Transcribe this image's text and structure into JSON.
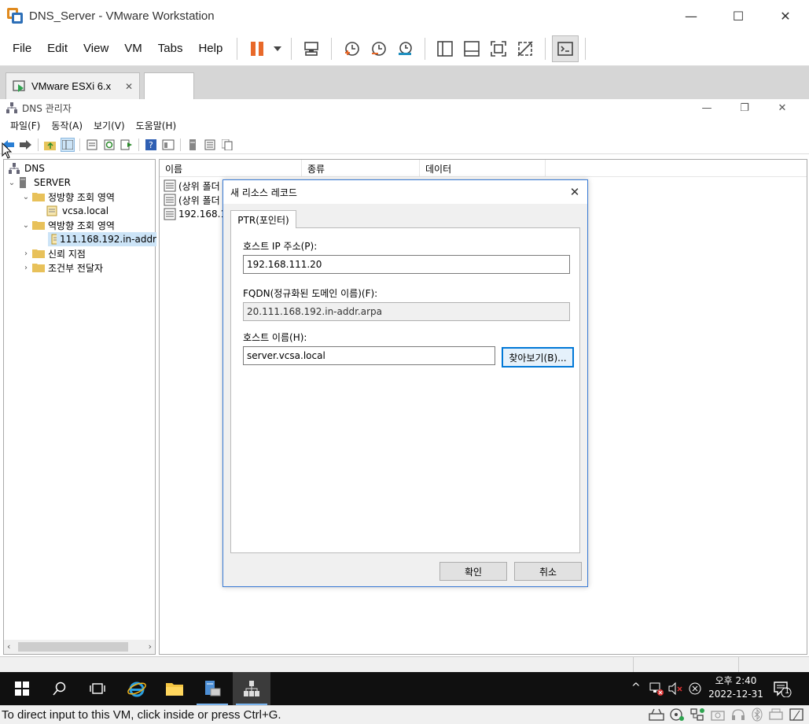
{
  "vmware": {
    "window_title": "DNS_Server - VMware Workstation",
    "menu": [
      "File",
      "Edit",
      "View",
      "VM",
      "Tabs",
      "Help"
    ],
    "tabs": [
      {
        "label": "VMware ESXi 6.x",
        "close": "✕"
      },
      {
        "label": ""
      }
    ],
    "status_message": "To direct input to this VM, click inside or press Ctrl+G."
  },
  "dns": {
    "window_title": "DNS 관리자",
    "menu": [
      "파일(F)",
      "동작(A)",
      "보기(V)",
      "도움말(H)"
    ],
    "tree": {
      "root": "DNS",
      "server": "SERVER",
      "forward_zones": "정방향 조회 영역",
      "forward_zone_1": "vcsa.local",
      "reverse_zones": "역방향 조회 영역",
      "reverse_zone_1": "111.168.192.in-addr",
      "trust_points": "신뢰 지점",
      "conditional_forwarders": "조건부 전달자"
    },
    "list": {
      "columns": [
        "이름",
        "종류",
        "데이터"
      ],
      "rows": [
        "(상위 폴더",
        "(상위 폴더",
        "192.168.1"
      ]
    }
  },
  "dialog": {
    "title": "새 리소스 레코드",
    "tab": "PTR(포인터)",
    "host_ip_label": "호스트 IP 주소(P):",
    "host_ip_value": "192.168.111.20",
    "fqdn_label": "FQDN(정규화된 도메인 이름)(F):",
    "fqdn_value": "20.111.168.192.in-addr.arpa",
    "host_name_label": "호스트 이름(H):",
    "host_name_value": "server.vcsa.local",
    "browse_button": "찾아보기(B)...",
    "ok_button": "확인",
    "cancel_button": "취소"
  },
  "taskbar": {
    "clock_time": "오후 2:40",
    "clock_date": "2022-12-31",
    "notification_count": "1"
  },
  "colors": {
    "accent": "#0078d7",
    "vmware_orange": "#e08a1e",
    "vmware_blue": "#2d6fb7",
    "taskbar": "#101010",
    "selection": "#cce4f7"
  }
}
